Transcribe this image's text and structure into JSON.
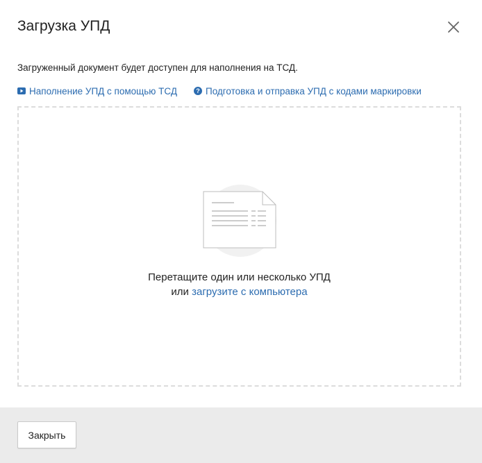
{
  "dialog": {
    "title": "Загрузка УПД",
    "description": "Загруженный документ будет доступен для наполнения на ТСД.",
    "links": [
      {
        "icon": "video-play-icon",
        "label": "Наполнение УПД с помощью ТСД"
      },
      {
        "icon": "help-circle-icon",
        "label": "Подготовка и отправка УПД с кодами маркировки"
      }
    ],
    "dropzone": {
      "line1": "Перетащите один или несколько УПД",
      "line2_prefix": "или ",
      "line2_link": "загрузите с компьютера"
    },
    "footer": {
      "close_label": "Закрыть"
    }
  },
  "colors": {
    "link": "#2c6cb0",
    "footer_bg": "#ebebeb",
    "dropzone_border": "#dcdcdc"
  }
}
